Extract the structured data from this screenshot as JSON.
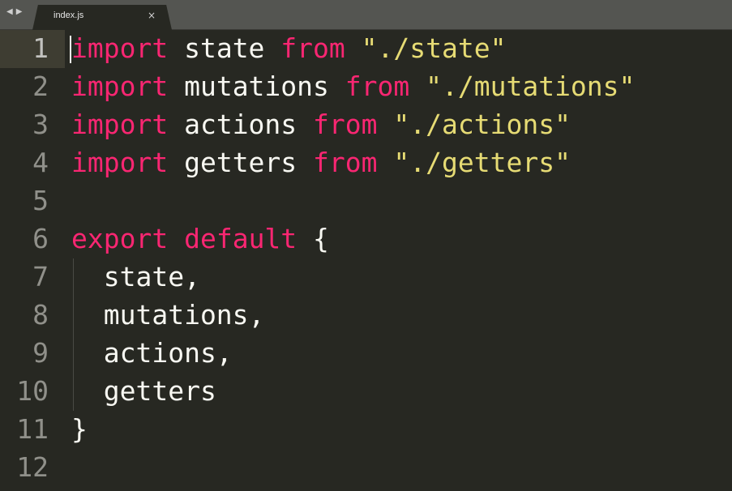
{
  "window": {
    "nav_back": "◀",
    "nav_forward": "▶"
  },
  "tab": {
    "label": "index.js",
    "close": "×"
  },
  "editor": {
    "line_numbers": [
      "1",
      "2",
      "3",
      "4",
      "5",
      "6",
      "7",
      "8",
      "9",
      "10",
      "11",
      "12"
    ],
    "lines": [
      {
        "tokens": [
          {
            "t": "kw",
            "v": "import"
          },
          {
            "t": "plain",
            "v": " state "
          },
          {
            "t": "kw",
            "v": "from"
          },
          {
            "t": "plain",
            "v": " "
          },
          {
            "t": "str",
            "v": "\"./state\""
          }
        ]
      },
      {
        "tokens": [
          {
            "t": "kw",
            "v": "import"
          },
          {
            "t": "plain",
            "v": " mutations "
          },
          {
            "t": "kw",
            "v": "from"
          },
          {
            "t": "plain",
            "v": " "
          },
          {
            "t": "str",
            "v": "\"./mutations\""
          }
        ]
      },
      {
        "tokens": [
          {
            "t": "kw",
            "v": "import"
          },
          {
            "t": "plain",
            "v": " actions "
          },
          {
            "t": "kw",
            "v": "from"
          },
          {
            "t": "plain",
            "v": " "
          },
          {
            "t": "str",
            "v": "\"./actions\""
          }
        ]
      },
      {
        "tokens": [
          {
            "t": "kw",
            "v": "import"
          },
          {
            "t": "plain",
            "v": " getters "
          },
          {
            "t": "kw",
            "v": "from"
          },
          {
            "t": "plain",
            "v": " "
          },
          {
            "t": "str",
            "v": "\"./getters\""
          }
        ]
      },
      {
        "tokens": []
      },
      {
        "tokens": [
          {
            "t": "kw",
            "v": "export"
          },
          {
            "t": "plain",
            "v": " "
          },
          {
            "t": "kw",
            "v": "default"
          },
          {
            "t": "plain",
            "v": " {"
          }
        ]
      },
      {
        "tokens": [
          {
            "t": "plain",
            "v": "  state,"
          }
        ]
      },
      {
        "tokens": [
          {
            "t": "plain",
            "v": "  mutations,"
          }
        ]
      },
      {
        "tokens": [
          {
            "t": "plain",
            "v": "  actions,"
          }
        ]
      },
      {
        "tokens": [
          {
            "t": "plain",
            "v": "  getters"
          }
        ]
      },
      {
        "tokens": [
          {
            "t": "plain",
            "v": "}"
          }
        ]
      },
      {
        "tokens": []
      }
    ]
  },
  "theme": {
    "background": "#272822",
    "keyword": "#f92672",
    "string": "#e6db74",
    "text": "#f8f8f2",
    "gutter": "#90908a"
  }
}
